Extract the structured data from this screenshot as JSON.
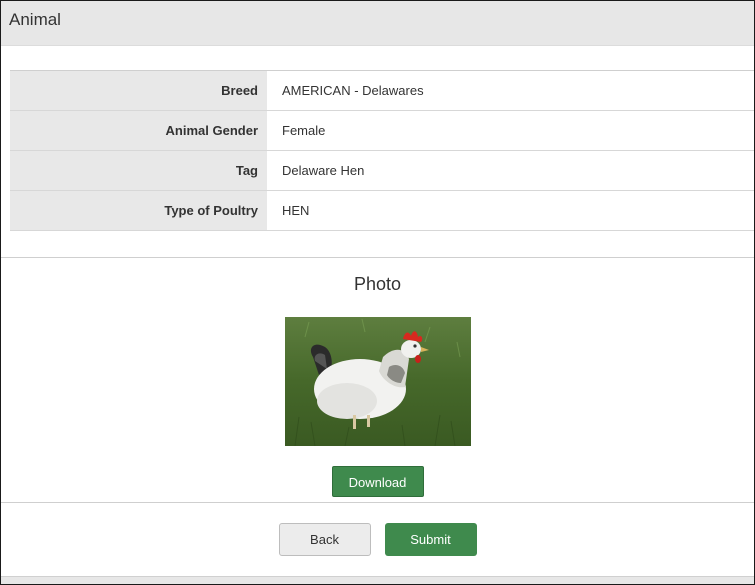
{
  "panel": {
    "title": "Animal"
  },
  "details": [
    {
      "label": "Breed",
      "value": "AMERICAN - Delawares"
    },
    {
      "label": "Animal Gender",
      "value": "Female"
    },
    {
      "label": "Tag",
      "value": "Delaware Hen"
    },
    {
      "label": "Type of Poultry",
      "value": "HEN"
    }
  ],
  "photo": {
    "title": "Photo",
    "download_label": "Download"
  },
  "actions": {
    "back_label": "Back",
    "submit_label": "Submit"
  },
  "colors": {
    "header_bg": "#e7e7e7",
    "label_bg": "#e8e8e8",
    "primary_green": "#3f8a4d",
    "secondary_btn": "#ececec"
  }
}
